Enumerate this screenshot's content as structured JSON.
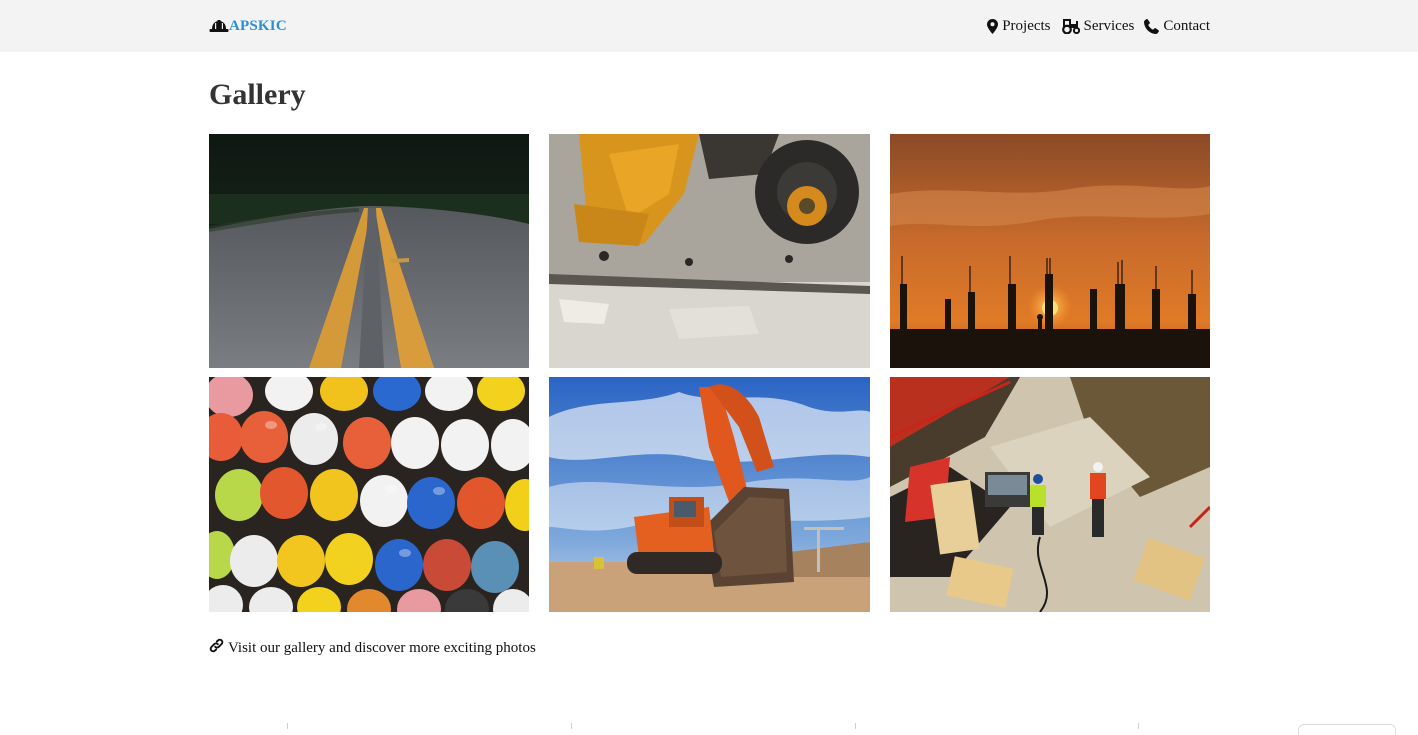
{
  "nav": {
    "brand": "APSKIC",
    "brand_icon": "hard-hat-icon",
    "links": [
      {
        "label": "Projects",
        "icon": "map-marker-icon"
      },
      {
        "label": "Services",
        "icon": "tractor-icon"
      },
      {
        "label": "Contact",
        "icon": "phone-icon"
      }
    ]
  },
  "page": {
    "title": "Gallery"
  },
  "gallery": {
    "images": [
      {
        "subject": "road"
      },
      {
        "subject": "bulldozer"
      },
      {
        "subject": "sunset-site"
      },
      {
        "subject": "hard-hats"
      },
      {
        "subject": "excavator"
      },
      {
        "subject": "workers"
      }
    ]
  },
  "more": {
    "label": "Visit our gallery and discover more exciting photos",
    "icon": "link-icon"
  },
  "colors": {
    "brand": "#2b8fd8",
    "navbar_bg": "#f3f3f3",
    "title": "#333333"
  }
}
